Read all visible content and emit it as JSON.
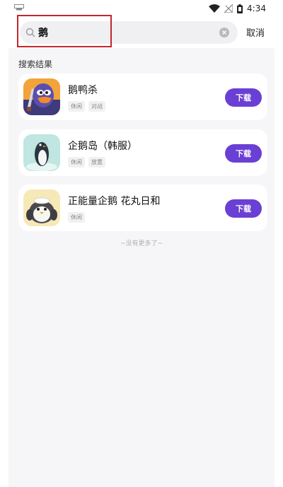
{
  "status_bar": {
    "time": "4:34",
    "icons": [
      "wifi-icon",
      "signal-off-icon",
      "battery-icon"
    ]
  },
  "search": {
    "query": "鹅",
    "cancel_label": "取消"
  },
  "results": {
    "section_title": "搜索结果",
    "items": [
      {
        "name": "鹅鸭杀",
        "tags": [
          "休闲",
          "对战"
        ],
        "download_label": "下载",
        "icon": "goose-duck-app-icon"
      },
      {
        "name": "企鹅岛（韩服）",
        "tags": [
          "休闲",
          "放置"
        ],
        "download_label": "下载",
        "icon": "penguin-isle-app-icon"
      },
      {
        "name": "正能量企鹅 花丸日和",
        "tags": [
          "休闲"
        ],
        "download_label": "下载",
        "icon": "positive-penguin-app-icon"
      }
    ],
    "end_text": "~没有更多了~"
  },
  "colors": {
    "accent": "#6a3fd4",
    "highlight_border": "#c4262e",
    "background": "#f6f6f8"
  }
}
